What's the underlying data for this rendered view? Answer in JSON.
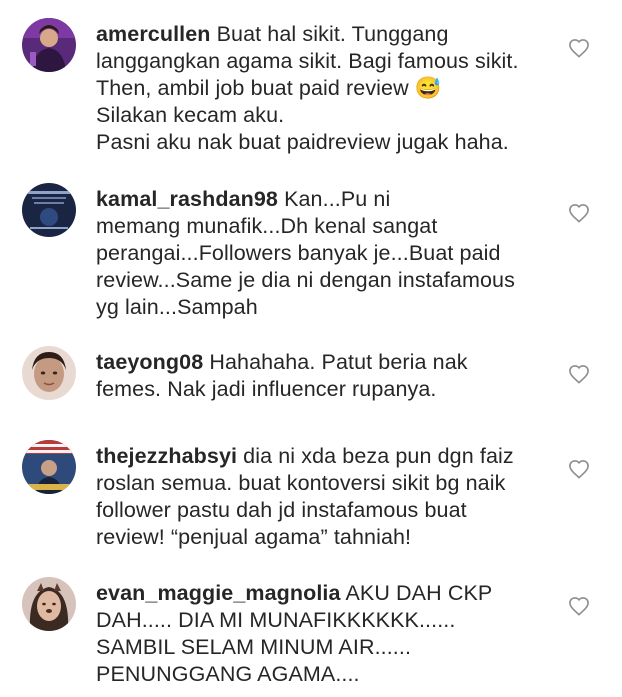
{
  "comments": [
    {
      "username": "amercullen",
      "text": "Buat hal sikit. Tunggang\nlanggangkan agama sikit. Bagi famous sikit.\nThen, ambil job buat paid review 😅\nSilakan kecam aku.\nPasni aku nak buat paidreview jugak haha.",
      "avatar_icon": "profile-photo-purple",
      "avatar_color": "#6b2f8f"
    },
    {
      "username": "kamal_rashdan98",
      "text": "Kan...Pu ni\nmemang munafik...Dh kenal sangat\nperangai...Followers banyak je...Buat paid\nreview...Same je dia ni dengan instafamous\nyg lain...Sampah",
      "avatar_icon": "profile-photo-dark-blue",
      "avatar_color": "#1d2a4a"
    },
    {
      "username": "taeyong08",
      "text": "Hahahaha. Patut beria nak\nfemes. Nak jadi influencer rupanya.",
      "avatar_icon": "profile-photo-face",
      "avatar_color": "#c9a48f"
    },
    {
      "username": "thejezzhabsyi",
      "text": "dia ni xda beza pun dgn faiz\nroslan semua. buat kontoversi sikit bg naik\nfollower pastu dah jd instafamous buat\nreview! “penjual agama” tahniah!",
      "avatar_icon": "profile-photo-poster",
      "avatar_color": "#3a5a8c"
    },
    {
      "username": "evan_maggie_magnolia",
      "text": "AKU DAH CKP\nDAH..... DIA MI MUNAFIKKKKKK......\nSAMBIL SELAM MINUM AIR......\nPENUNGGANG AGAMA....",
      "avatar_icon": "profile-photo-filter",
      "avatar_color": "#b08e80"
    }
  ],
  "like_icon": "heart-outline-icon",
  "like_icon_color": "#8e8e8e"
}
